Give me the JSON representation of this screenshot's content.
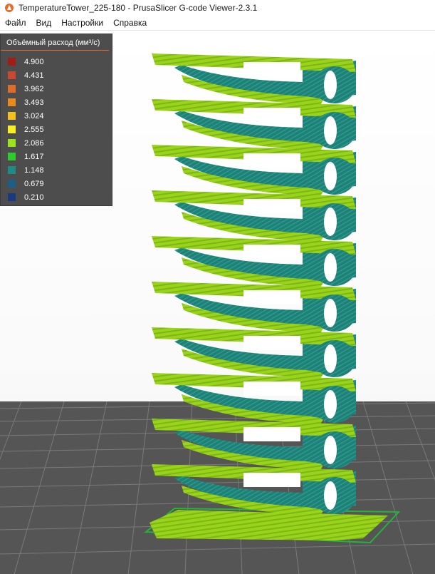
{
  "window": {
    "title": "TemperatureTower_225-180 - PrusaSlicer G-code Viewer-2.3.1",
    "icon": "prusa-app-icon"
  },
  "menu": {
    "items": [
      "Файл",
      "Вид",
      "Настройки",
      "Справка"
    ]
  },
  "legend": {
    "title": "Объёмный расход (мм³/с)",
    "entries": [
      {
        "value": "4.900",
        "color": "#a31c15"
      },
      {
        "value": "4.431",
        "color": "#c9482f"
      },
      {
        "value": "3.962",
        "color": "#e06c2b"
      },
      {
        "value": "3.493",
        "color": "#e88a1c"
      },
      {
        "value": "3.024",
        "color": "#f2c21a"
      },
      {
        "value": "2.555",
        "color": "#f7f020"
      },
      {
        "value": "2.086",
        "color": "#9de31c"
      },
      {
        "value": "1.617",
        "color": "#2ccc2a"
      },
      {
        "value": "1.148",
        "color": "#1e8c85"
      },
      {
        "value": "0.679",
        "color": "#1b5f86"
      },
      {
        "value": "0.210",
        "color": "#1a3a80"
      }
    ]
  },
  "scene": {
    "colors": {
      "bed": "#555555",
      "grid": "#7a7a7a",
      "fill_green": "#9bd31a",
      "fill_green_dark": "#7ab816",
      "wall_teal": "#1f8078",
      "outline_green": "#25b33a"
    },
    "tower_level_count": 10
  }
}
